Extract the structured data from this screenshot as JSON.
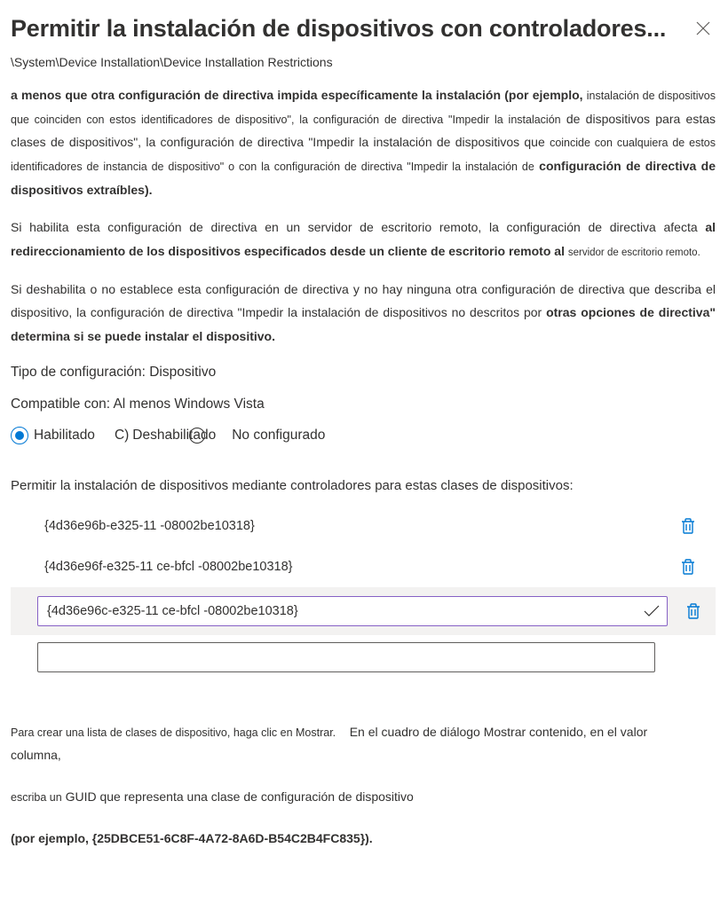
{
  "header": {
    "title": "Permitir la instalación de dispositivos con controladores..."
  },
  "breadcrumb": "\\System\\Device Installation\\Device Installation Restrictions",
  "description": {
    "p1a": "a menos que otra configuración de directiva impida específicamente la instalación (por ejemplo,",
    "p1b": "instalación de dispositivos que coinciden con estos identificadores de dispositivo\", la configuración de directiva \"Impedir la instalación",
    "p1c": "de dispositivos para estas clases de dispositivos\", la configuración de directiva \"Impedir la instalación de dispositivos que",
    "p1d": "coincide con cualquiera de estos identificadores de instancia de dispositivo\" o con la configuración de directiva \"Impedir la instalación de",
    "p1e": "configuración de directiva de dispositivos extraíbles).",
    "p2a": "Si habilita esta configuración de directiva en un servidor de escritorio remoto, la configuración de directiva afecta",
    "p2b": "al redireccionamiento de los dispositivos especificados desde un cliente de escritorio remoto al",
    "p2c": "servidor de escritorio remoto.",
    "p3a": "Si deshabilita o no establece esta configuración de directiva y no hay ninguna otra configuración de directiva que describa el dispositivo, la configuración de directiva \"Impedir la instalación de dispositivos no descritos por",
    "p3b": "otras opciones de directiva\" determina si se puede instalar el dispositivo."
  },
  "config_type": "Tipo de configuración: Dispositivo",
  "compatible": "Compatible con: Al menos Windows Vista",
  "radios": {
    "enabled": "Habilitado",
    "disabled_prefix": "C)",
    "disabled": "Deshabilitado",
    "not_configured": "No configurado"
  },
  "list": {
    "label": "Permitir la instalación de dispositivos mediante controladores para estas clases de dispositivos:",
    "items": [
      "{4d36e96b-e325-11 -08002be10318}",
      "{4d36e96f-e325-11 ce-bfcl -08002be10318}"
    ],
    "editing_value": "{4d36e96c-e325-11 ce-bfcl -08002be10318}"
  },
  "footer": {
    "p1a": "Para crear una lista de clases de dispositivo, haga clic en Mostrar.",
    "p1b": "En el cuadro de diálogo Mostrar contenido, en el valor",
    "p1c": "columna,",
    "p2a": "escriba un",
    "p2b": "GUID que representa una clase de configuración de dispositivo",
    "p3": "(por ejemplo, {25DBCE51-6C8F-4A72-8A6D-B54C2B4FC835})."
  }
}
